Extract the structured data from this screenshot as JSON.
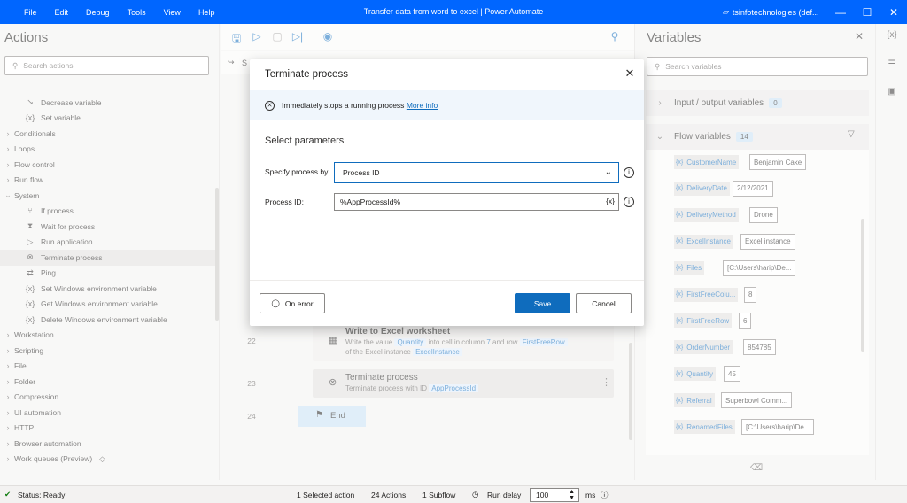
{
  "titlebar": {
    "menu": [
      "File",
      "Edit",
      "Debug",
      "Tools",
      "View",
      "Help"
    ],
    "title": "Transfer data from word to excel | Power Automate",
    "account": "tsinfotechnologies (def..."
  },
  "actions": {
    "title": "Actions",
    "search_placeholder": "Search actions",
    "items": [
      {
        "label": "Decrease variable",
        "icon": "decrease-icon",
        "glyph": "↘",
        "level": 1
      },
      {
        "label": "Set variable",
        "icon": "variable-icon",
        "glyph": "{x}",
        "level": 1
      },
      {
        "label": "Conditionals",
        "level": 0
      },
      {
        "label": "Loops",
        "level": 0
      },
      {
        "label": "Flow control",
        "level": 0
      },
      {
        "label": "Run flow",
        "level": 0
      },
      {
        "label": "System",
        "level": 0,
        "expanded": true
      },
      {
        "label": "If process",
        "icon": "branch-icon",
        "glyph": "⑂",
        "level": 1
      },
      {
        "label": "Wait for process",
        "icon": "hourglass-icon",
        "glyph": "⧗",
        "level": 1
      },
      {
        "label": "Run application",
        "icon": "play-icon",
        "glyph": "▷",
        "level": 1
      },
      {
        "label": "Terminate process",
        "icon": "terminate-icon",
        "glyph": "⊗",
        "level": 1,
        "selected": true
      },
      {
        "label": "Ping",
        "icon": "ping-icon",
        "glyph": "⇄",
        "level": 1
      },
      {
        "label": "Set Windows environment variable",
        "icon": "variable-icon",
        "glyph": "{x}",
        "level": 1
      },
      {
        "label": "Get Windows environment variable",
        "icon": "variable-icon",
        "glyph": "{x}",
        "level": 1
      },
      {
        "label": "Delete Windows environment variable",
        "icon": "variable-icon",
        "glyph": "{x}",
        "level": 1
      },
      {
        "label": "Workstation",
        "level": 0
      },
      {
        "label": "Scripting",
        "level": 0
      },
      {
        "label": "File",
        "level": 0
      },
      {
        "label": "Folder",
        "level": 0
      },
      {
        "label": "Compression",
        "level": 0
      },
      {
        "label": "UI automation",
        "level": 0
      },
      {
        "label": "HTTP",
        "level": 0
      },
      {
        "label": "Browser automation",
        "level": 0
      },
      {
        "label": "Work queues (Preview)",
        "level": 0,
        "premium": true
      }
    ]
  },
  "designer": {
    "subtab_partial": "S",
    "steps": {
      "s22": {
        "num": "22",
        "title": "Write to Excel worksheet",
        "line1_pre": "Write the value",
        "line1_var": "Quantity",
        "line1_mid": "into cell in column",
        "line1_col": "7",
        "line1_and": "and row",
        "line1_row": "FirstFreeRow",
        "line2_pre": "of the Excel instance",
        "line2_var": "ExcelInstance"
      },
      "s23": {
        "num": "23",
        "title": "Terminate process",
        "line1_pre": "Terminate process with ID",
        "line1_var": "AppProcessId"
      },
      "s24": {
        "num": "24",
        "title": "End"
      }
    }
  },
  "variables": {
    "title": "Variables",
    "search_placeholder": "Search variables",
    "io_label": "Input / output variables",
    "io_count": "0",
    "flow_label": "Flow variables",
    "flow_count": "14",
    "items": [
      {
        "name": "CustomerName",
        "value": "Benjamin Cake"
      },
      {
        "name": "DeliveryDate",
        "value": "2/12/2021"
      },
      {
        "name": "DeliveryMethod",
        "value": "Drone"
      },
      {
        "name": "ExcelInstance",
        "value": "Excel instance"
      },
      {
        "name": "Files",
        "value": "[C:\\Users\\harip\\De..."
      },
      {
        "name": "FirstFreeColu...",
        "value": "8"
      },
      {
        "name": "FirstFreeRow",
        "value": "6"
      },
      {
        "name": "OrderNumber",
        "value": "854785"
      },
      {
        "name": "Quantity",
        "value": "45"
      },
      {
        "name": "Referral",
        "value": "Superbowl Comm..."
      },
      {
        "name": "RenamedFiles",
        "value": "[C:\\Users\\harip\\De..."
      }
    ]
  },
  "status": {
    "ready": "Status: Ready",
    "selected": "1 Selected action",
    "actions": "24 Actions",
    "subflow": "1 Subflow",
    "run_delay": "Run delay",
    "delay_value": "100",
    "unit": "ms"
  },
  "dialog": {
    "title": "Terminate process",
    "info_text": "Immediately stops a running process",
    "more_info": "More info",
    "section": "Select parameters",
    "specify_label": "Specify process by:",
    "specify_value": "Process ID",
    "pid_label": "Process ID:",
    "pid_value": "%AppProcessId%",
    "var_btn": "{x}",
    "on_error": "On error",
    "save": "Save",
    "cancel": "Cancel"
  }
}
